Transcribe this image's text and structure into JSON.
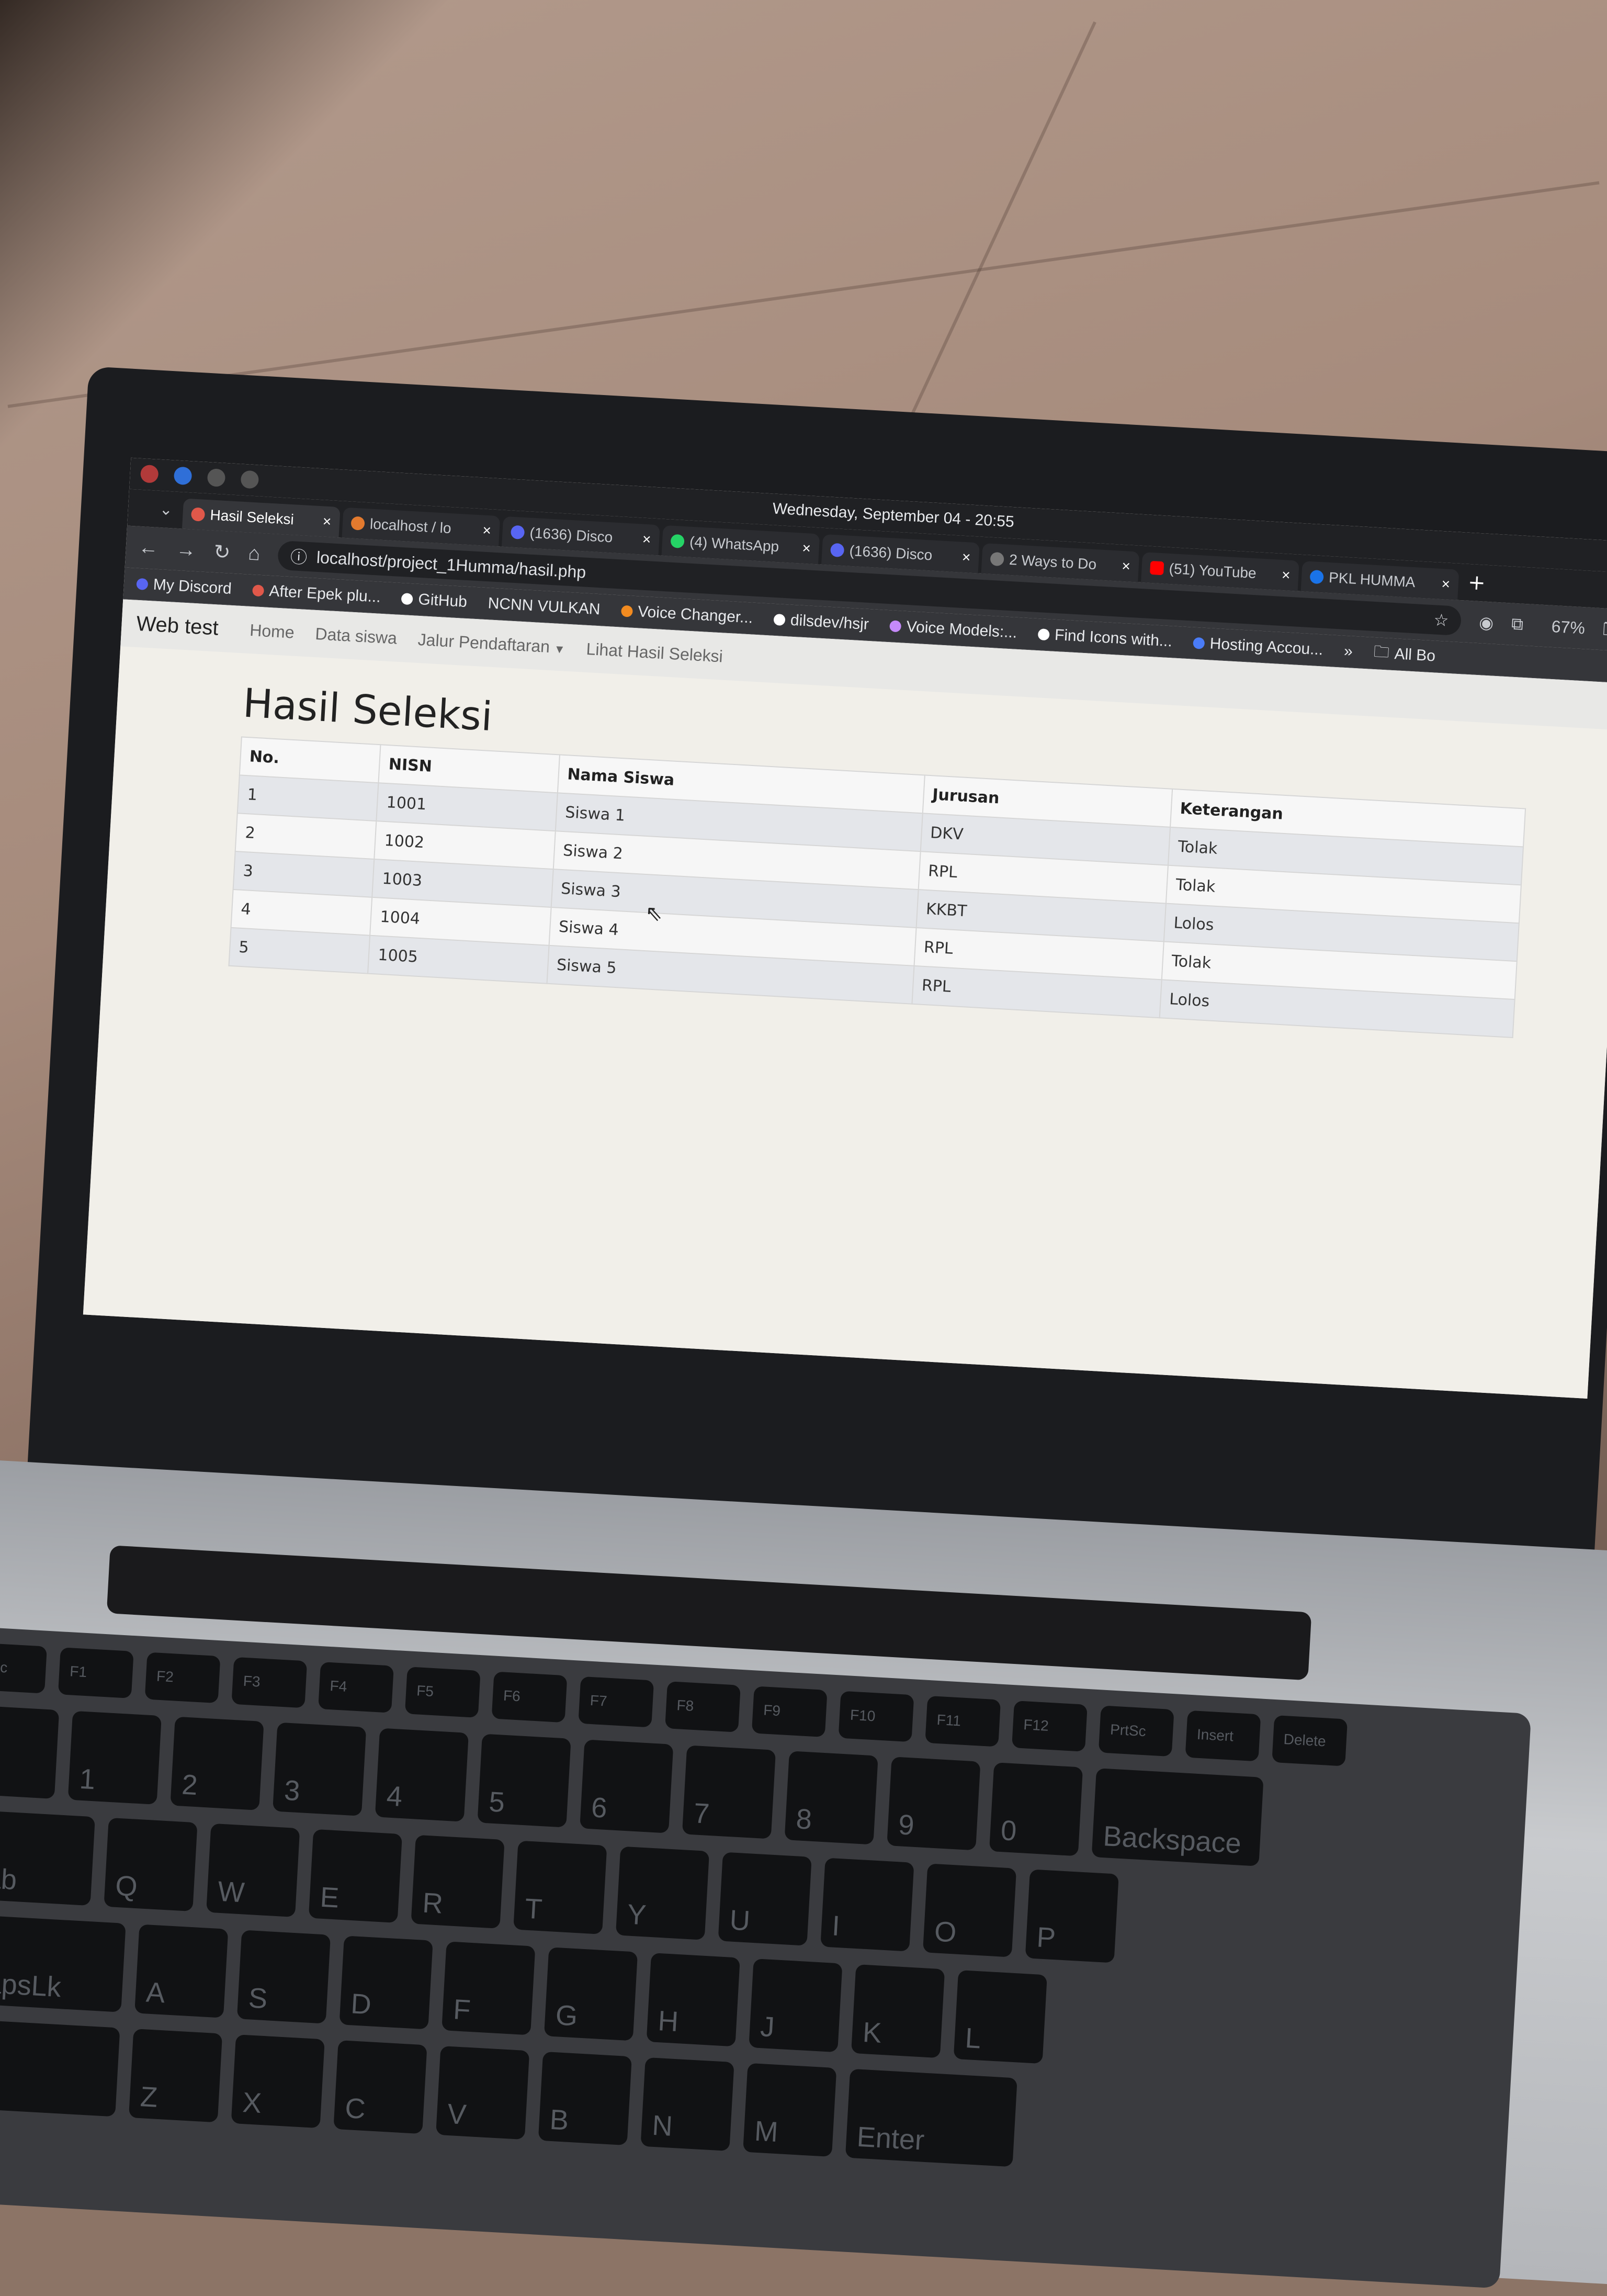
{
  "os": {
    "clock": "Wednesday, September 04 - 20:55",
    "battery": "67%"
  },
  "tabs": [
    {
      "title": "Hasil Seleksi",
      "active": true
    },
    {
      "title": "localhost / lo",
      "active": false
    },
    {
      "title": "(1636) Disco",
      "active": false
    },
    {
      "title": "(4) WhatsApp",
      "active": false
    },
    {
      "title": "(1636) Disco",
      "active": false
    },
    {
      "title": "2 Ways to Do",
      "active": false
    },
    {
      "title": "(51) YouTube",
      "active": false
    },
    {
      "title": "PKL HUMMA",
      "active": false
    }
  ],
  "toolbar": {
    "url": "localhost/project_1Humma/hasil.php"
  },
  "bookmarks": [
    "My Discord",
    "After Epek plu...",
    "GitHub",
    "NCNN VULKAN",
    "Voice Changer...",
    "dilsdev/hsjr",
    "Voice Models:...",
    "Find Icons with...",
    "Hosting Accou...",
    "All Bo"
  ],
  "navbar": {
    "brand": "Web test",
    "links": [
      "Home",
      "Data siswa",
      "Jalur Pendaftaran",
      "Lihat Hasil Seleksi"
    ]
  },
  "page": {
    "title": "Hasil Seleksi"
  },
  "table": {
    "headers": [
      "No.",
      "NISN",
      "Nama Siswa",
      "Jurusan",
      "Keterangan"
    ],
    "rows": [
      [
        "1",
        "1001",
        "Siswa 1",
        "DKV",
        "Tolak"
      ],
      [
        "2",
        "1002",
        "Siswa 2",
        "RPL",
        "Tolak"
      ],
      [
        "3",
        "1003",
        "Siswa 3",
        "KKBT",
        "Lolos"
      ],
      [
        "4",
        "1004",
        "Siswa 4",
        "RPL",
        "Tolak"
      ],
      [
        "5",
        "1005",
        "Siswa 5",
        "RPL",
        "Lolos"
      ]
    ]
  },
  "keyboard": {
    "fn_row": [
      "Esc",
      "F1",
      "F2",
      "F3",
      "F4",
      "F5",
      "F6",
      "F7",
      "F8",
      "F9",
      "F10",
      "F11",
      "F12",
      "PrtSc",
      "Insert",
      "Delete"
    ],
    "num_row": [
      "1",
      "2",
      "3",
      "4",
      "5",
      "6",
      "7",
      "8",
      "9",
      "0",
      "Backspace"
    ],
    "top_row": [
      "Tab",
      "Q",
      "W",
      "E",
      "R",
      "T",
      "Y",
      "U",
      "I",
      "O",
      "P"
    ],
    "home_row": [
      "CapsLk",
      "A",
      "S",
      "D",
      "F",
      "G",
      "H",
      "J",
      "K",
      "L"
    ],
    "bottom_row": [
      "Z",
      "X",
      "C",
      "V",
      "B",
      "N",
      "M",
      "Enter"
    ]
  }
}
